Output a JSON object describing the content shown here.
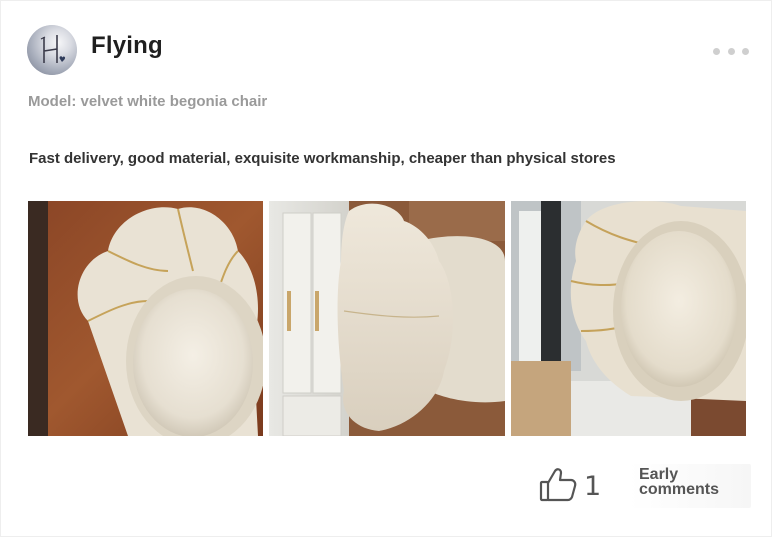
{
  "post": {
    "author": {
      "name": "Flying",
      "avatar_icon": "user-avatar"
    },
    "more_icon": "more-horizontal-icon",
    "model": "Model: velvet white begonia chair",
    "review": "Fast delivery, good material, exquisite workmanship, cheaper than physical stores",
    "photos": [
      {
        "name": "chair-photo-1",
        "subject": "white velvet begonia chair, front view on wooden floor"
      },
      {
        "name": "chair-photo-2",
        "subject": "chair backrest close-up beside white cabinet"
      },
      {
        "name": "chair-photo-3",
        "subject": "chair backrest from side near window"
      }
    ],
    "likes": {
      "icon": "thumbs-up-icon",
      "count": "1"
    },
    "comments": {
      "label": "Early comments"
    }
  },
  "colors": {
    "card_bg": "#ffffff",
    "page_bg": "#f2f2f2",
    "title_text": "#1f1f1f",
    "muted_text": "#9a9a9a",
    "body_text": "#333333"
  }
}
